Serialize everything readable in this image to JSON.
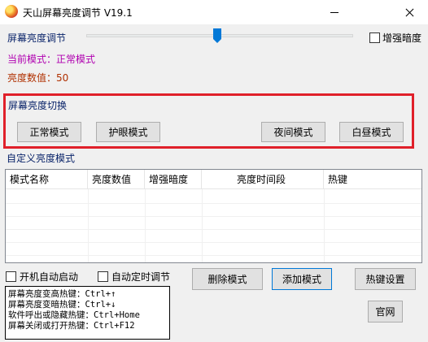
{
  "window": {
    "title": "天山屏幕亮度调节 V19.1"
  },
  "brightness": {
    "slider_label": "屏幕亮度调节",
    "slider_value_fraction": 0.49,
    "enhance_dark_label": "增强暗度",
    "enhance_dark_checked": false,
    "current_mode_label": "当前模式：正常模式",
    "current_value_label": "亮度数值：50"
  },
  "switch_group": {
    "title": "屏幕亮度切换",
    "buttons": [
      "正常模式",
      "护眼模式",
      "夜间模式",
      "白昼模式"
    ]
  },
  "custom": {
    "title": "自定义亮度模式",
    "columns": [
      "模式名称",
      "亮度数值",
      "增强暗度",
      "亮度时间段",
      "热键"
    ],
    "rows": []
  },
  "options": {
    "autostart_label": "开机自动启动",
    "autostart_checked": false,
    "timed_label": "自动定时调节",
    "timed_checked": false
  },
  "actions": {
    "delete_label": "删除模式",
    "add_label": "添加模式",
    "hotkey_settings_label": "热键设置",
    "website_label": "官网"
  },
  "hotkeys_info": [
    "屏幕亮度变高热键：Ctrl+↑",
    "屏幕亮度变暗热键：Ctrl+↓",
    "软件呼出或隐藏热键：Ctrl+Home",
    "屏幕关闭或打开热键：Ctrl+F12"
  ],
  "colors": {
    "highlight_frame": "#e0202a",
    "group_title": "#0a246a",
    "current_mode": "#b000b0",
    "current_value": "#b03000",
    "slider_thumb": "#0078d7"
  }
}
